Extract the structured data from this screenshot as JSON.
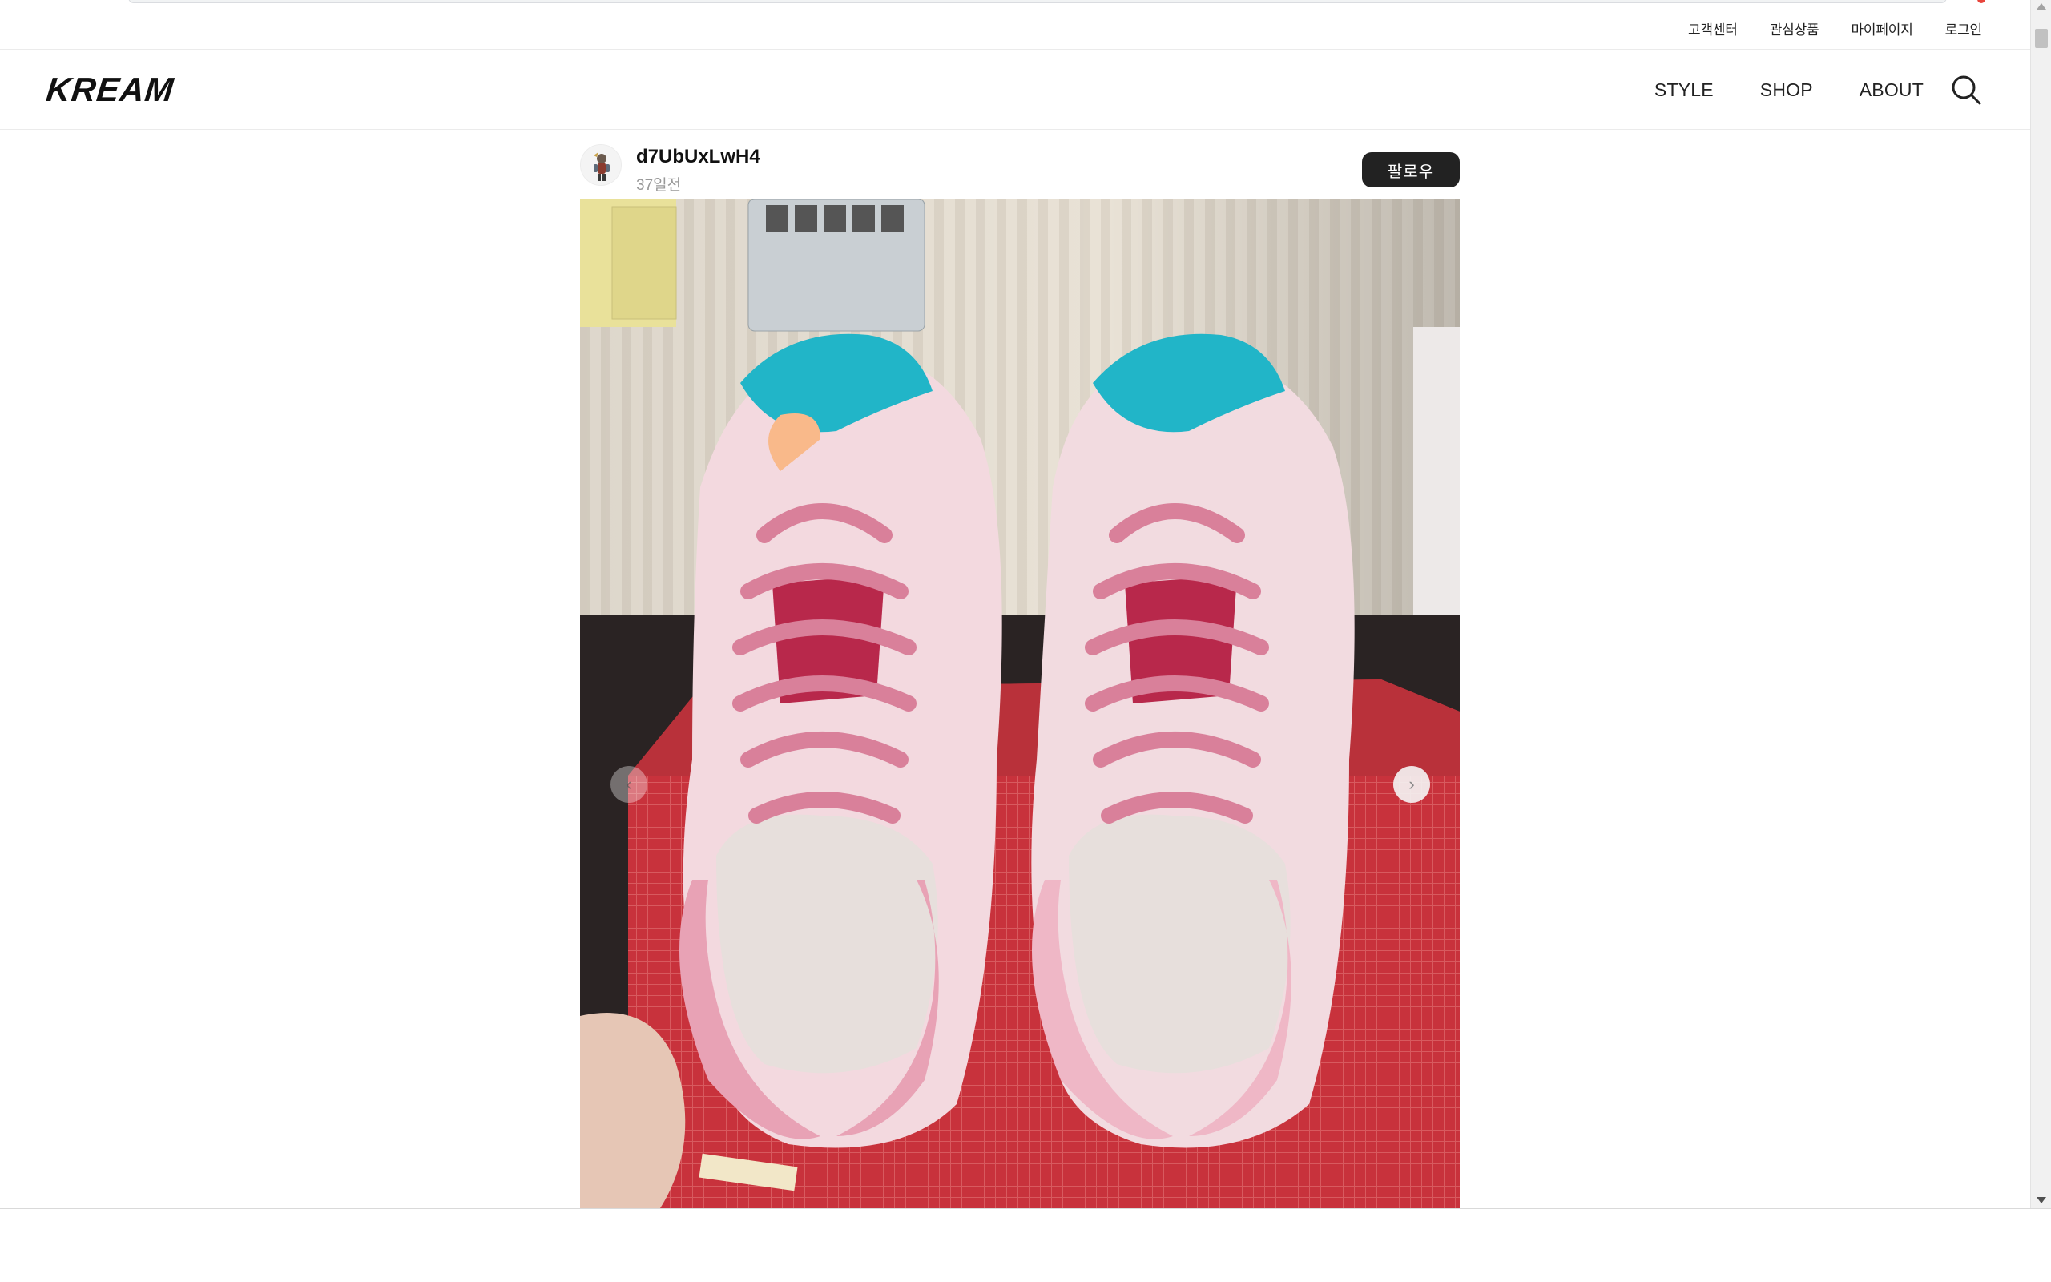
{
  "utility_nav": {
    "items": [
      "고객센터",
      "관심상품",
      "마이페이지",
      "로그인"
    ]
  },
  "header": {
    "logo": "KREAM",
    "nav": [
      "STYLE",
      "SHOP",
      "ABOUT"
    ],
    "search_icon": "search-icon"
  },
  "post": {
    "username": "d7UbUxLwH4",
    "time_ago": "37일전",
    "follow_label": "팔로우",
    "prev_icon": "chevron-left-icon",
    "next_icon": "chevron-right-icon",
    "image_subject": "pink-sneakers-photo",
    "prev_glyph": "‹",
    "next_glyph": "›"
  },
  "colors": {
    "follow_button_bg": "#222222",
    "text_primary": "#222222",
    "text_secondary": "#999999"
  }
}
